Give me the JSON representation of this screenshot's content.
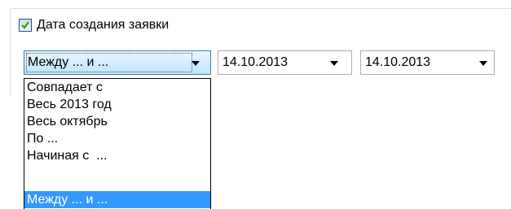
{
  "filter": {
    "checkbox_label": "Дата создания заявки",
    "checked": true
  },
  "range_combo": {
    "value": "Между ... и ...",
    "options": [
      "Совпадает с",
      "Весь 2013 год",
      "Весь октябрь",
      "По ...",
      "Начиная с  ...",
      "Между ... и ..."
    ],
    "selected_index": 5
  },
  "date_from": {
    "value": "14.10.2013"
  },
  "date_to": {
    "value": "14.10.2013"
  },
  "colors": {
    "selection": "#3399ff",
    "combo_focus_border": "#3c7fb1",
    "checkbox_border": "#1c5180",
    "checkmark": "#21a121"
  },
  "icons": {
    "checkmark": "checkmark-icon",
    "dropdown_arrow": "chevron-down-icon"
  }
}
